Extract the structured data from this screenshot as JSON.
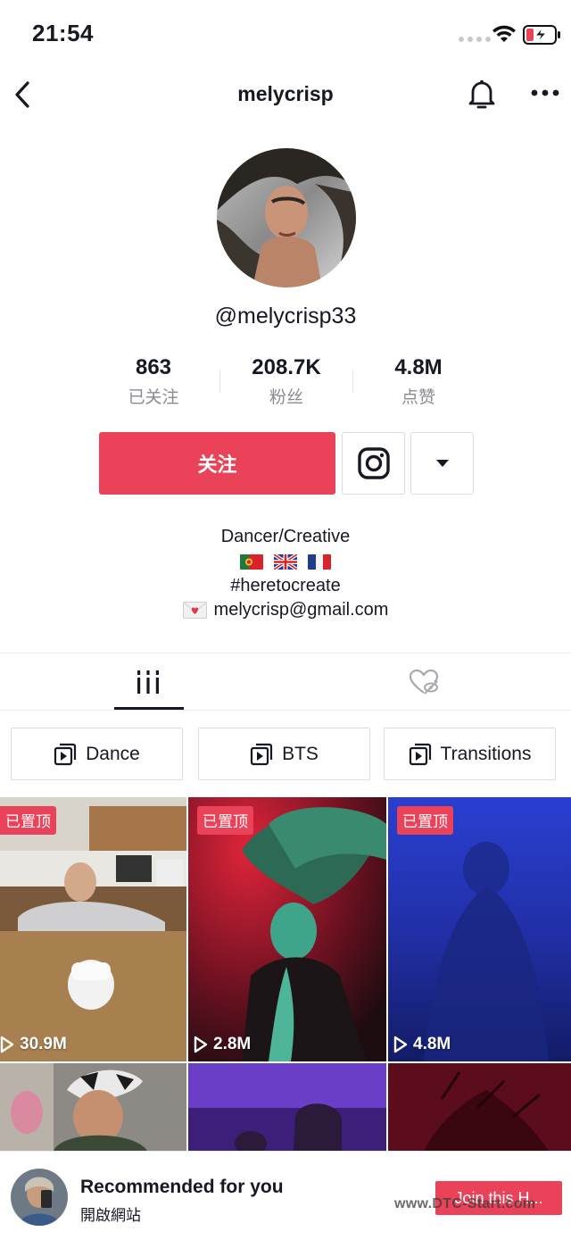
{
  "status_bar": {
    "time": "21:54"
  },
  "header": {
    "title": "melycrisp"
  },
  "profile": {
    "handle": "@melycrisp33",
    "stats": [
      {
        "value": "863",
        "label": "已关注"
      },
      {
        "value": "208.7K",
        "label": "粉丝"
      },
      {
        "value": "4.8M",
        "label": "点赞"
      }
    ],
    "follow_label": "关注",
    "bio_title": "Dancer/Creative",
    "bio_hashtag": "#heretocreate",
    "bio_email": "melycrisp@gmail.com"
  },
  "playlists": [
    {
      "label": "Dance"
    },
    {
      "label": "BTS"
    },
    {
      "label": "Transitions"
    }
  ],
  "videos": [
    {
      "pinned": "已置顶",
      "views": "30.9M"
    },
    {
      "pinned": "已置顶",
      "views": "2.8M"
    },
    {
      "pinned": "已置顶",
      "views": "4.8M"
    }
  ],
  "recommendation": {
    "title": "Recommended for you",
    "subtitle": "開啟網站",
    "button": "Join this H...",
    "watermark": "www.DTC-Start.com"
  },
  "colors": {
    "accent": "#ea4359",
    "text": "#161823",
    "muted": "#8a8b91"
  }
}
